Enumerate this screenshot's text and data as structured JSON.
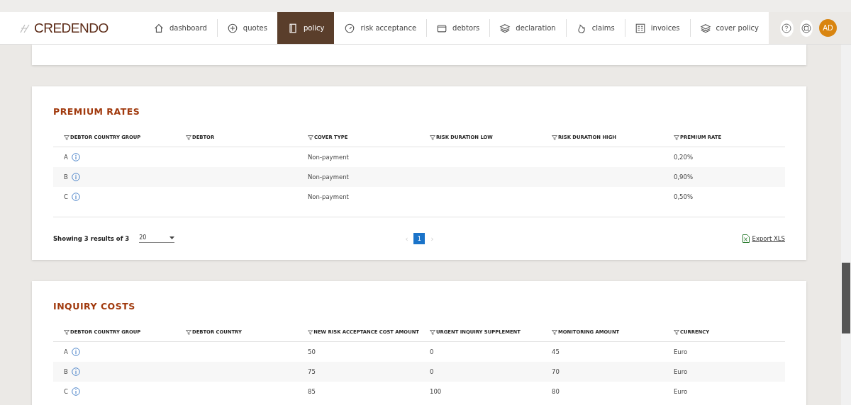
{
  "nav": {
    "logo": "CREDENDO",
    "tabs": [
      {
        "label": "dashboard",
        "selected": false
      },
      {
        "label": "quotes",
        "selected": false
      },
      {
        "label": "policy",
        "selected": true
      },
      {
        "label": "risk acceptance",
        "selected": false
      },
      {
        "label": "debtors",
        "selected": false
      },
      {
        "label": "declaration",
        "selected": false
      },
      {
        "label": "claims",
        "selected": false
      },
      {
        "label": "invoices",
        "selected": false
      },
      {
        "label": "cover policy",
        "selected": false
      }
    ],
    "avatar": "AD"
  },
  "sections": [
    {
      "title": "PREMIUM RATES",
      "columns": [
        "DEBTOR COUNTRY GROUP",
        "DEBTOR",
        "COVER TYPE",
        "RISK DURATION LOW",
        "RISK DURATION HIGH",
        "PREMIUM RATE"
      ],
      "rows": [
        [
          "A",
          "",
          "Non-payment",
          "",
          "",
          "0,20%"
        ],
        [
          "B",
          "",
          "Non-payment",
          "",
          "",
          "0,90%"
        ],
        [
          "C",
          "",
          "Non-payment",
          "",
          "",
          "0,50%"
        ]
      ],
      "footer": {
        "summary": "Showing 3 results of 3",
        "page_size": "20",
        "prev": "‹",
        "pages": [
          {
            "label": "1",
            "selected": true
          }
        ],
        "next": "›",
        "export": "Export XLS"
      }
    },
    {
      "title": "INQUIRY COSTS",
      "columns": [
        "DEBTOR COUNTRY GROUP",
        "DEBTOR COUNTRY",
        "NEW RISK ACCEPTANCE COST AMOUNT",
        "URGENT INQUIRY SUPPLEMENT",
        "MONITORING AMOUNT",
        "CURRENCY"
      ],
      "rows": [
        [
          "A",
          "",
          "50",
          "0",
          "45",
          "Euro"
        ],
        [
          "B",
          "",
          "75",
          "0",
          "70",
          "Euro"
        ],
        [
          "C",
          "",
          "85",
          "100",
          "80",
          "Euro"
        ]
      ]
    }
  ]
}
